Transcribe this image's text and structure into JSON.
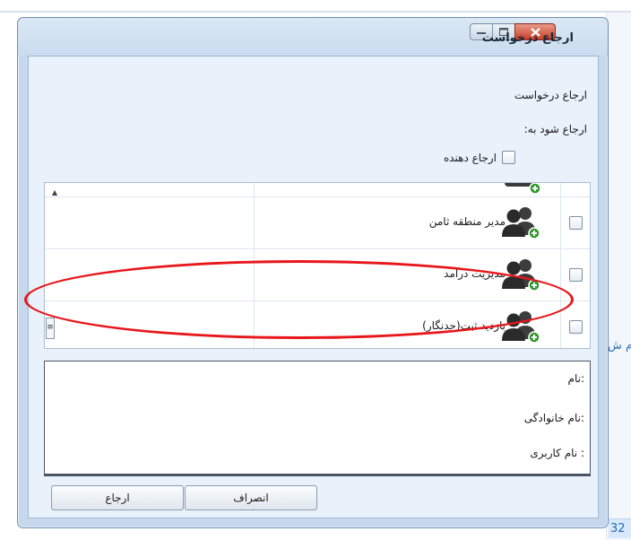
{
  "background": {
    "side_text": "ام ش",
    "number": "32"
  },
  "dialog": {
    "title": "ارجاع درخواست",
    "buttons": {
      "minimize_icon": "minimize-icon",
      "maximize_icon": "maximize-icon",
      "close_icon": "close-icon"
    },
    "labels": {
      "request_title": "ارجاع درخواست",
      "refer_to": "ارجاع شود به:"
    },
    "refer_to_giver": {
      "label": "ارجاع دهنده",
      "checked": false
    },
    "grid": {
      "rows": [
        {
          "name": "مدیر منطقه ثامن",
          "checked": false,
          "icon": "users-add-icon"
        },
        {
          "name": "مدیریت درآمد",
          "checked": false,
          "icon": "users-add-icon"
        },
        {
          "name": "بازدید ثبت(حدنگار)",
          "checked": false,
          "icon": "users-add-icon",
          "highlighted": true
        }
      ]
    },
    "details": {
      "first_name": ":نام",
      "last_name": ":نام خانوادگی",
      "username": ": نام کاربری"
    },
    "footer": {
      "cancel_label": "انصراف",
      "return_label": "ارجاع"
    },
    "colors": {
      "highlight": "#e8161b",
      "close_button": "#c6402a",
      "frame": "#c6d9ec"
    }
  }
}
